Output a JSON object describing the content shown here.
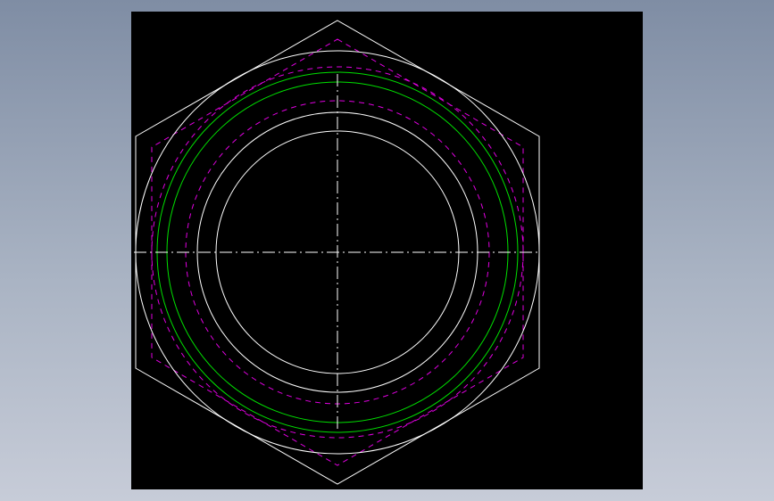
{
  "app": {
    "background_gradient": [
      "#7f8da4",
      "#a9b3c3",
      "#c7ccd8"
    ],
    "viewport_background": "#000000"
  },
  "drawing": {
    "subject": "hex-nut-top-view",
    "colors": {
      "outline": "#ffffff",
      "thread": "#00e000",
      "hidden": "#e000e0",
      "centerline": "#ffffff"
    },
    "line_styles": {
      "hidden_dash": "6 5",
      "centerline_dash": "14 4 2 4"
    }
  }
}
